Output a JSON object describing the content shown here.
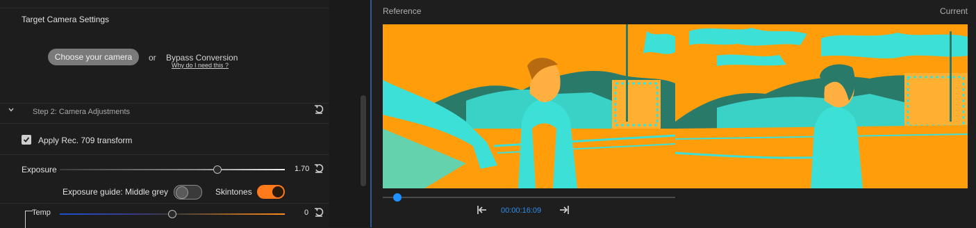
{
  "left": {
    "section_title": "Target Camera Settings",
    "choose_camera_label": "Choose your camera",
    "or_label": "or",
    "bypass_label": "Bypass Conversion",
    "why_link": "Why do I need this ?",
    "step2_title": "Step 2: Camera Adjustments",
    "apply_rec709_label": "Apply Rec. 709 transform",
    "apply_rec709_checked": true,
    "exposure": {
      "label": "Exposure",
      "value": "1.70",
      "level": 0.7
    },
    "exposure_guide": {
      "label": "Exposure guide:",
      "middle_grey_label": "Middle grey",
      "middle_grey_on": false,
      "skintones_label": "Skintones",
      "skintones_on": true
    },
    "temp": {
      "label": "Temp",
      "value": "0",
      "level": 0.5
    }
  },
  "viewer": {
    "reference_label": "Reference",
    "current_label": "Current",
    "timecode": "00:00:16:09",
    "scrub_level": 0.05
  },
  "colors": {
    "accent_blue": "#1e90ff",
    "toggle_orange": "#ff7a1a",
    "image_orange": "#ff9d0a",
    "image_cyan": "#3de0d6"
  }
}
